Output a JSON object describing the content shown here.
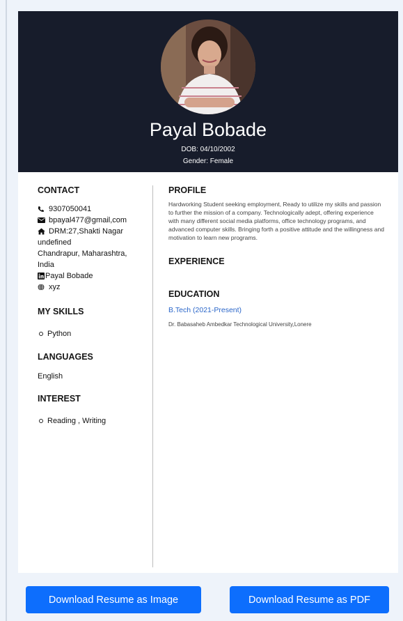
{
  "header": {
    "name": "Payal Bobade",
    "dob": "DOB: 04/10/2002",
    "gender": "Gender: Female",
    "background_color": "#171c2b"
  },
  "contact": {
    "title": "CONTACT",
    "phone": "9307050041",
    "email": "bpayal477@gmail,com",
    "address_line1": "DRM:27,Shakti Nagar",
    "address_line2": "undefined",
    "address_line3": "Chandrapur, Maharashtra,",
    "address_line4": "India",
    "linkedin": "Payal Bobade",
    "website": "xyz"
  },
  "skills": {
    "title": "MY SKILLS",
    "items": [
      "Python"
    ]
  },
  "languages": {
    "title": "LANGUAGES",
    "items": [
      "English"
    ]
  },
  "interest": {
    "title": "INTEREST",
    "items": [
      "Reading , Writing"
    ]
  },
  "profile": {
    "title": "PROFILE",
    "text": "Hardworking Student seeking employment, Ready to utilize my skills and passion to further the mission of a company. Technologically adept, offering experience with many different social media platforms, office technology programs, and advanced computer skills. Bringing forth a positive attitude and the willingness and motivation to learn new programs."
  },
  "experience": {
    "title": "EXPERIENCE"
  },
  "education": {
    "title": "EDUCATION",
    "degree": "B.Tech  (2021-Present)",
    "university": "Dr. Babasaheb Ambedkar Technological University,Lonere",
    "degree_color": "#2a66c9"
  },
  "actions": {
    "download_image": "Download Resume as Image",
    "download_pdf": "Download Resume as PDF",
    "button_color": "#0d6efd"
  },
  "icons": [
    "phone-icon",
    "envelope-icon",
    "home-icon",
    "linkedin-icon",
    "globe-icon"
  ]
}
